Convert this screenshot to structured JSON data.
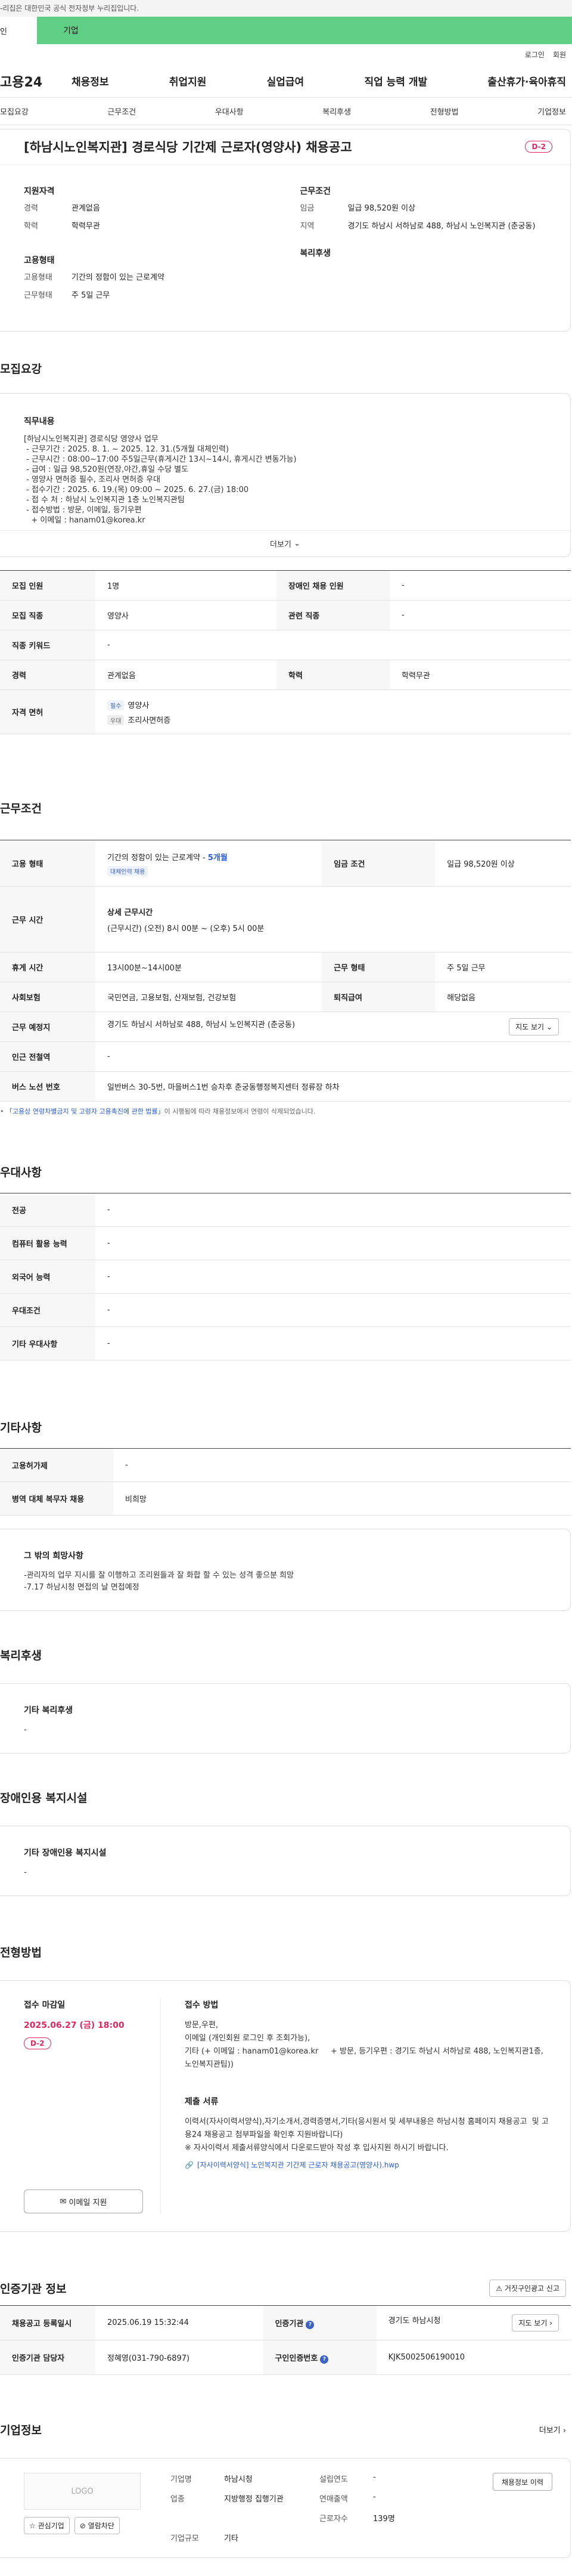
{
  "notice": "-리집은 대한민국 공식 전자정부 누리집입니다.",
  "usertabs": [
    "인",
    "기업"
  ],
  "util": [
    "로그인",
    "회원"
  ],
  "logo": "고용24",
  "gnb": [
    "채용정보",
    "취업지원",
    "실업급여",
    "직업 능력 개발",
    "출산휴가·육아휴직"
  ],
  "tabs": [
    "모집요강",
    "근무조건",
    "우대사항",
    "복리후생",
    "전형방법",
    "기업정보"
  ],
  "header": {
    "title": "[하남시노인복지관] 경로식당 기간제 근로자(영양사) 채용공고",
    "dday": "D-2",
    "qual_title": "지원자격",
    "career_k": "경력",
    "career_v": "관계없음",
    "edu_k": "학력",
    "edu_v": "학력무관",
    "cond_title": "근무조건",
    "wage_k": "임금",
    "wage_v": "일급 98,520원 이상",
    "region_k": "지역",
    "region_v": "경기도 하남시 서하남로 488, 하남시 노인복지관 (춘궁동)",
    "emp_title": "고용형태",
    "type_k": "고용형태",
    "type_v": "기간의 정함이 있는 근로계약",
    "work_k": "근무형태",
    "work_v": "주 5일 근무",
    "welfare_title": "복리후생"
  },
  "recruit": {
    "section": "모집요강",
    "job_title": "직무내용",
    "job_text": "[하남시노인복지관] 경로식당 영양사 업무\n - 근무기간 : 2025. 8. 1. ~ 2025. 12. 31.(5개월 대체인력)\n - 근무시간 : 08:00~17:00 주5일근무(휴게시간 13시~14시, 휴게시간 변동가능)\n - 급여 : 일급 98,520원(연장,야간,휴일 수당 별도\n - 영양사 면허증 필수, 조리사 면허증 우대\n - 접수기간 : 2025. 6. 19.(목) 09:00 ~ 2025. 6. 27.(금) 18:00\n - 접 수 처 : 하남시 노인복지관 1층 노인복지관팀\n - 접수방법 : 방문, 이메일, 등기우편\n   + 이메일 : hanam01@korea.kr",
    "more": "더보기",
    "rows": [
      {
        "k1": "모집 인원",
        "v1": "1명",
        "k2": "장애인 채용 인원",
        "v2": "-"
      },
      {
        "k1": "모집 직종",
        "v1": "영양사",
        "k2": "관련 직종",
        "v2": "-"
      },
      {
        "k1": "직종 키워드",
        "v1": "-"
      },
      {
        "k1": "경력",
        "v1": "관계없음",
        "k2": "학력",
        "v2": "학력무관"
      }
    ],
    "license_k": "자격 면허",
    "license_chip1": "필수",
    "license_v1": "영양사",
    "license_chip2": "우대",
    "license_v2": "조리사면허증"
  },
  "conditions": {
    "section": "근무조건",
    "emp_k": "고용 형태",
    "emp_v": "기간의 정함이 있는 근로계약 - ",
    "emp_months": "5개월",
    "emp_chip": "대체인력 채용",
    "wage_k": "임금 조건",
    "wage_v": "일급 98,520원 이상",
    "time_k": "근무 시간",
    "time_title": "상세 근무시간",
    "time_v": "(근무시간) (오전) 8시 00분 ~ (오후) 5시 00분",
    "rest_k": "휴게 시간",
    "rest_v": "13시00분~14시00분",
    "form_k": "근무 형태",
    "form_v": "주 5일 근무",
    "ins_k": "사회보험",
    "ins_v": "국민연금, 고용보험, 산재보험, 건강보험",
    "ret_k": "퇴직급여",
    "ret_v": "해당없음",
    "place_k": "근무 예정지",
    "place_v": "경기도 하남시 서하남로 488, 하남시 노인복지관 (춘궁동)",
    "map": "지도 보기",
    "sub_k": "인근 전철역",
    "sub_v": "-",
    "bus_k": "버스 노선 번호",
    "bus_v": "일반버스 30-5번, 마을버스1번 승차후 춘궁동행정복지센터 정류장 하차",
    "note_link": "「고용상 연령차별금지 및 고령자 고용촉진에 관한 법률」",
    "note_rest": "이 시행됨에 따라 채용정보에서 연령이 삭제되었습니다."
  },
  "preferences": {
    "section": "우대사항",
    "rows": [
      {
        "k": "전공",
        "v": "-"
      },
      {
        "k": "컴퓨터 활용 능력",
        "v": "-"
      },
      {
        "k": "외국어 능력",
        "v": "-"
      },
      {
        "k": "우대조건",
        "v": "-"
      },
      {
        "k": "기타 우대사항",
        "v": "-"
      }
    ]
  },
  "etc": {
    "section": "기타사항",
    "rows": [
      {
        "k": "고용허가제",
        "v": "-"
      },
      {
        "k": "병역 대체 복무자 채용",
        "v": "비희망"
      }
    ],
    "box_title": "그 밖의 희망사항",
    "box_text": "-관리자의 업무 지시를 잘 이행하고 조리원들과 잘 화합 할 수 있는 성격 좋으분 희망\n-7.17 하남시청 면접의 날 면접예정"
  },
  "welfare": {
    "section": "복리후생",
    "title": "기타 복리후생",
    "v": "-"
  },
  "disability": {
    "section": "장애인용 복지시설",
    "title": "기타 장애인용 복지시설",
    "v": "-"
  },
  "selection": {
    "section": "전형방법",
    "deadline_k": "접수 마감일",
    "deadline_v": "2025.06.27 (금) 18:00",
    "dday": "D-2",
    "email_btn": "이메일 지원",
    "method_title": "접수 방법",
    "method_text": "방문,우편,\n이메일 (개인회원 로그인 후 조회가능),\n기타 (+ 이메일 : hanam01@korea.kr     + 방문, 등기우편 : 경기도 하남시 서하남로 488, 노인복지관1층, 노인복지관팀))",
    "docs_title": "제출 서류",
    "docs_text": "이력서(자사이력서양식),자기소개서,경력증명서,기타(응시원서 및 세부내용은 하남시청 홈페이지 채용공고  및 고용24 채용공고 첨부파일을 확인후 지원바랍니다)\n※ 자사이력서 제출서류양식에서 다운로드받아 작성 후 입사지원 하시기 바랍니다.",
    "file": "[자사이력서양식] 노인복지관 기간제 근로자 채용공고(영양사).hwp"
  },
  "cert": {
    "section": "인증기관 정보",
    "report_btn": "거짓구인광고 신고",
    "reg_k": "채용공고 등록일시",
    "reg_v": "2025.06.19 15:32:44",
    "org_k": "인증기관",
    "org_v": "경기도 하남시청",
    "map": "지도 보기",
    "mgr_k": "인증기관 담당자",
    "mgr_v": "정혜영(031-790-6897)",
    "id_k": "구인인증번호",
    "id_v": "KJK5002506190010"
  },
  "company": {
    "section": "기업정보",
    "more": "더보기",
    "logo": "LOGO",
    "fav": "관심기업",
    "hide": "열람차단",
    "name_k": "기업명",
    "name_v": "하남시청",
    "year_k": "설립연도",
    "year_v": "-",
    "ind_k": "업종",
    "ind_v": "지방행정 집행기관",
    "sales_k": "연매출액",
    "sales_v": "-",
    "emp_k": "근로자수",
    "emp_v": "139명",
    "scale_k": "기업규모",
    "scale_v": "기타",
    "hired_btn": "채용정보 이력"
  }
}
